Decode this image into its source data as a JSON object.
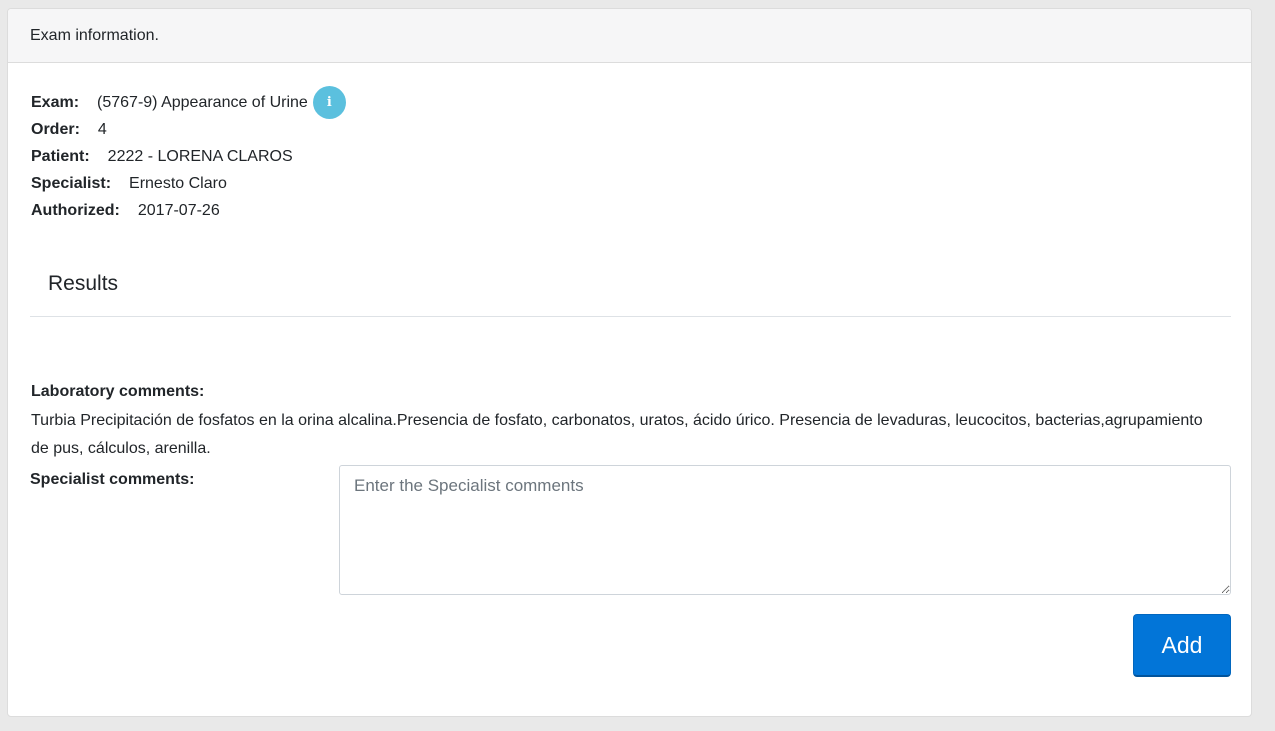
{
  "card": {
    "header_title": "Exam information."
  },
  "info": {
    "exam": {
      "label": "Exam:",
      "value": "(5767-9) Appearance of Urine"
    },
    "order": {
      "label": "Order:",
      "value": "4"
    },
    "patient": {
      "label": "Patient:",
      "value": "2222 - LORENA CLAROS"
    },
    "specialist": {
      "label": "Specialist:",
      "value": "Ernesto Claro"
    },
    "authorized": {
      "label": "Authorized:",
      "value": "2017-07-26"
    },
    "info_icon_glyph": "i",
    "info_icon_color": "#5bc0de"
  },
  "results": {
    "title": "Results",
    "laboratory_comments_label": "Laboratory comments:",
    "laboratory_comments_text": "Turbia Precipitación de fosfatos en la orina alcalina.Presencia de fosfato, carbonatos, uratos, ácido úrico. Presencia de levaduras, leucocitos, bacterias,agrupamiento de pus, cálculos, arenilla.",
    "specialist_comments_label": "Specialist comments:",
    "specialist_comments_placeholder": "Enter the Specialist comments",
    "specialist_comments_value": ""
  },
  "actions": {
    "add_label": "Add",
    "add_color": "#0275d8"
  }
}
